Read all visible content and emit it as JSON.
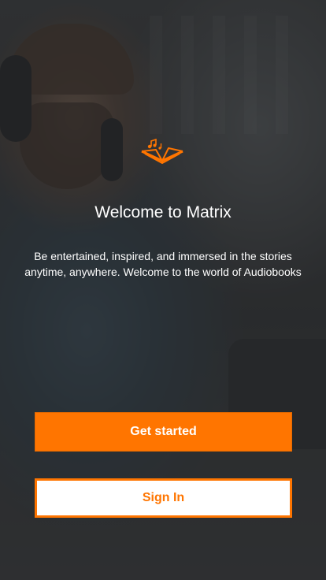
{
  "app": {
    "logo_icon": "open-book-music-icon",
    "accent_color": "#ff7500"
  },
  "welcome": {
    "title": "Welcome to Matrix",
    "description_line1": "Be entertained, inspired, and immersed in the stories",
    "description_line2": "anytime, anywhere. Welcome to the world of Audiobooks"
  },
  "actions": {
    "get_started_label": "Get started",
    "sign_in_label": "Sign In"
  }
}
